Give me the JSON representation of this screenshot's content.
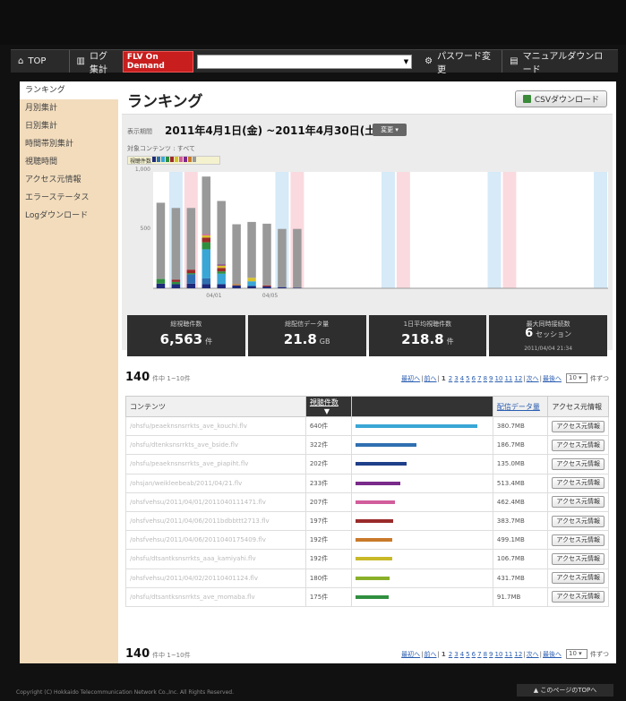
{
  "nav": {
    "top_label": "TOP",
    "log_label": "ログ集計",
    "flv_logo": "FLV On Demand",
    "flv_select_value": "",
    "password_label": "パスワード変更",
    "manual_label": "マニュアルダウンロード"
  },
  "sidebar": {
    "items": [
      {
        "label": "ランキング",
        "active": true
      },
      {
        "label": "月別集計"
      },
      {
        "label": "日別集計"
      },
      {
        "label": "時間帯別集計"
      },
      {
        "label": "視聴時間"
      },
      {
        "label": "アクセス元情報"
      },
      {
        "label": "エラーステータス"
      },
      {
        "label": "Logダウンロード"
      }
    ]
  },
  "main": {
    "title": "ランキング",
    "csv_button": "CSVダウンロード",
    "period_label": "表示期間",
    "period_value": "2011年4月1日(金) ~2011年4月30日(土)",
    "change_button": "変更 ▾",
    "target_label": "対象コンテンツ : すべて",
    "legend_label": "視聴件数"
  },
  "chart_data": {
    "type": "bar",
    "stacked": true,
    "ylim": [
      0,
      1000
    ],
    "y_ticks": [
      "1,000",
      "500"
    ],
    "x_labels": [
      "04/01",
      "04/05"
    ],
    "days": 30,
    "weekend_days": {
      "saturday": [
        2,
        9,
        16,
        23,
        30
      ],
      "sunday": [
        3,
        10,
        17,
        24
      ]
    },
    "series_colors": [
      "#1e2a7a",
      "#2f6fb0",
      "#3aa6d6",
      "#2f8f3f",
      "#9a2a2a",
      "#d8c22a",
      "#d25d9c",
      "#7a2a8a",
      "#c97a2a",
      "#999999"
    ],
    "values": [
      [
        40,
        35,
        40,
        35,
        35,
        25,
        20,
        15,
        10,
        5
      ],
      [
        0,
        0,
        80,
        50,
        0,
        0,
        0,
        0,
        0,
        0,
        0,
        0,
        0,
        0
      ],
      [
        0,
        0,
        0,
        250,
        90,
        0,
        40,
        0,
        0,
        0,
        0,
        0,
        0,
        0
      ],
      [
        40,
        20,
        10,
        60,
        20,
        0,
        0,
        0,
        0,
        0,
        0,
        0,
        0,
        0
      ],
      [
        0,
        20,
        30,
        40,
        30,
        0,
        0,
        10,
        0,
        0,
        0,
        0,
        0,
        0
      ],
      [
        0,
        0,
        0,
        20,
        20,
        0,
        30,
        0,
        0,
        0,
        0,
        0,
        0,
        0
      ],
      [
        0,
        0,
        0,
        10,
        0,
        0,
        0,
        0,
        0,
        0,
        0,
        0,
        0,
        0
      ],
      [
        0,
        0,
        0,
        0,
        10,
        0,
        0,
        0,
        0,
        0,
        0,
        0,
        0,
        0
      ],
      [
        0,
        0,
        0,
        0,
        0,
        10,
        0,
        0,
        0,
        0,
        0,
        0,
        0,
        0
      ],
      [
        655,
        615,
        530,
        495,
        545,
        515,
        480,
        530,
        500,
        505
      ]
    ]
  },
  "stats": [
    {
      "label": "総視聴件数",
      "value": "6,563",
      "unit": "件"
    },
    {
      "label": "総配信データ量",
      "value": "21.8",
      "unit": "GB"
    },
    {
      "label": "1日平均視聴件数",
      "value": "218.8",
      "unit": "件"
    },
    {
      "label": "最大同時接続数",
      "value": "6",
      "unit": "セッション",
      "sub": "2011/04/04 21:34"
    }
  ],
  "listing": {
    "total": "140",
    "range": "件中 1~10件",
    "pager": {
      "first": "最初へ",
      "prev": "前へ",
      "current": "1",
      "pages": [
        "2",
        "3",
        "4",
        "5",
        "6",
        "7",
        "8",
        "9",
        "10",
        "11",
        "12"
      ],
      "next": "次へ",
      "last": "最後へ",
      "per_page": "10",
      "per_suffix": "件ずつ"
    }
  },
  "table": {
    "headers": {
      "content": "コンテンツ",
      "count": "視聴件数",
      "data": "配信データ量",
      "access": "アクセス元情報"
    },
    "info_button": "アクセス元情報",
    "rows": [
      {
        "content": "/ohsfu/peaeknsnsrrkts_ave_kouchi.flv",
        "count": "640件",
        "ratio": 1.0,
        "color": "#3aa6d6",
        "data": "380.7MB"
      },
      {
        "content": "/ohsfu/dtenksnsrrkts_ave_bside.flv",
        "count": "322件",
        "ratio": 0.503,
        "color": "#2f6fb0",
        "data": "186.7MB"
      },
      {
        "content": "/ohsfu/peaeknsnsrrkts_ave_piapiht.flv",
        "count": "202件",
        "ratio": 0.416,
        "color": "#1e3f8a",
        "data": "135.0MB"
      },
      {
        "content": "/ohsjan/weikleebeab/2011/04/21.flv",
        "count": "233件",
        "ratio": 0.364,
        "color": "#7a2a8a",
        "data": "513.4MB"
      },
      {
        "content": "/ohsfvehsu/2011/04/01/2011040111471.flv",
        "count": "207件",
        "ratio": 0.323,
        "color": "#d25d9c",
        "data": "462.4MB"
      },
      {
        "content": "/ohsfvehsu/2011/04/06/2011bdbbttt2713.flv",
        "count": "197件",
        "ratio": 0.308,
        "color": "#9a2a2a",
        "data": "383.7MB"
      },
      {
        "content": "/ohsfvehsu/2011/04/06/2011040175409.flv",
        "count": "192件",
        "ratio": 0.3,
        "color": "#c97a2a",
        "data": "499.1MB"
      },
      {
        "content": "/ohsfu/dtsantksnsrrkts_aaa_kamiyahi.flv",
        "count": "192件",
        "ratio": 0.3,
        "color": "#c8b928",
        "data": "106.7MB"
      },
      {
        "content": "/ohsfvehsu/2011/04/02/20110401124.flv",
        "count": "180件",
        "ratio": 0.281,
        "color": "#8ab02a",
        "data": "431.7MB"
      },
      {
        "content": "/ohsfu/dtsantksnsrrkts_ave_momaba.flv",
        "count": "175件",
        "ratio": 0.273,
        "color": "#2f8f3f",
        "data": "91.7MB"
      }
    ]
  },
  "footer": {
    "copyright": "Copyright (C) Hokkaido Telecommunication Network Co.,Inc. All Rights Reserved.",
    "to_top": "▲ このページのTOPへ"
  }
}
